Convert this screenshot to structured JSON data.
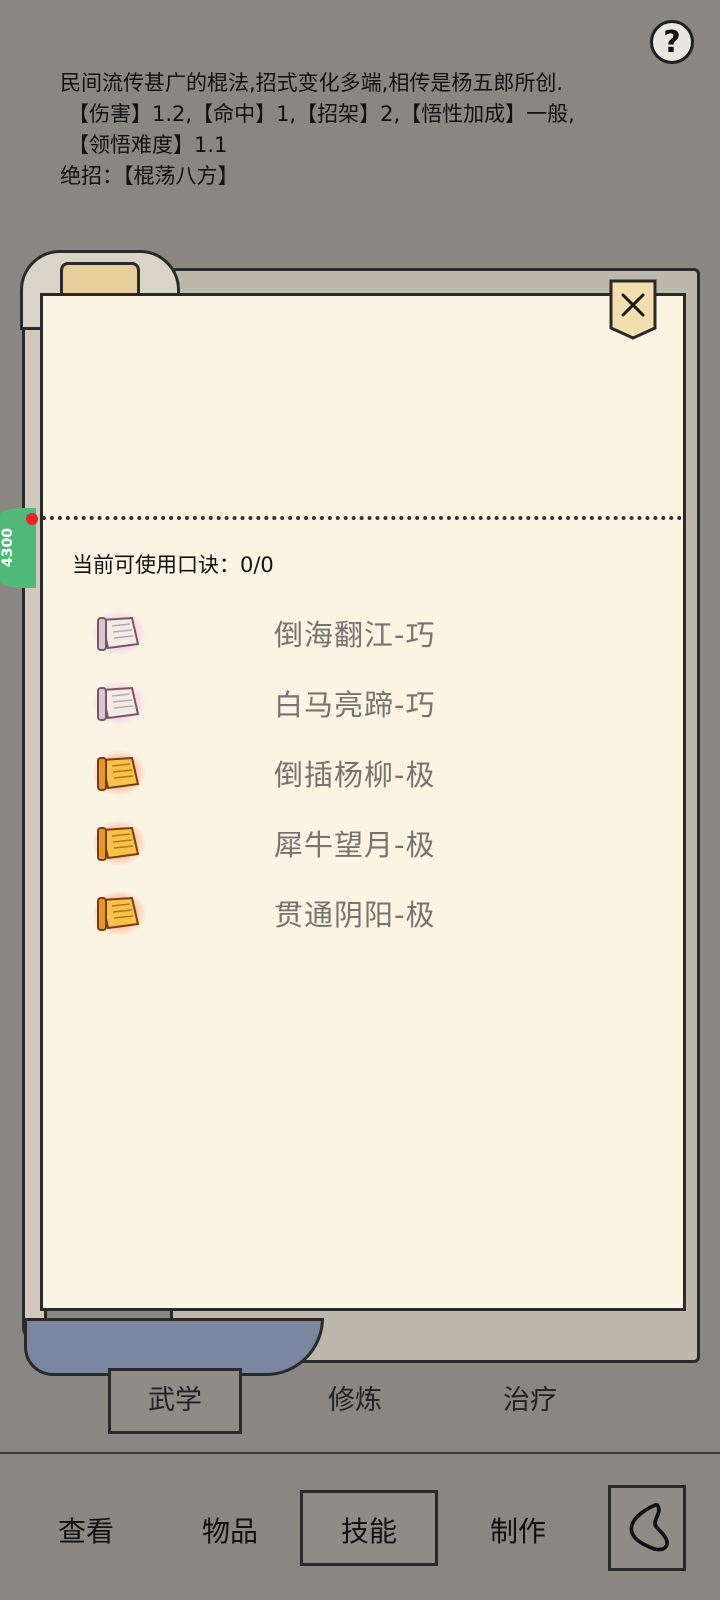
{
  "help": {
    "label": "?"
  },
  "description": {
    "line1": "民间流传甚广的棍法,招式变化多端,相传是杨五郎所创.",
    "line2": "【伤害】1.2,【命中】1,【招架】2,【悟性加成】一般,",
    "line3": "【领悟难度】1.1",
    "line4": "绝招：【棍荡八方】"
  },
  "side_badge": {
    "value": "4300"
  },
  "koujue": {
    "label": "当前可使用口诀：0/0"
  },
  "skills": [
    {
      "name": "倒海翻江-巧",
      "icon": "scroll-white-icon"
    },
    {
      "name": "白马亮蹄-巧",
      "icon": "scroll-white-icon"
    },
    {
      "name": "倒插杨柳-极",
      "icon": "scroll-gold-icon"
    },
    {
      "name": "犀牛望月-极",
      "icon": "scroll-gold-icon"
    },
    {
      "name": "贯通阴阳-极",
      "icon": "scroll-gold-icon"
    }
  ],
  "subtabs": {
    "wuxue": "武学",
    "xiulian": "修炼",
    "zhiliao": "治疗"
  },
  "nav": {
    "chakan": "查看",
    "wupin": "物品",
    "jineng": "技能",
    "zhizuo": "制作"
  },
  "colors": {
    "paper": "#fbf4e3",
    "background": "#8a8782",
    "skill_text": "#777470"
  }
}
